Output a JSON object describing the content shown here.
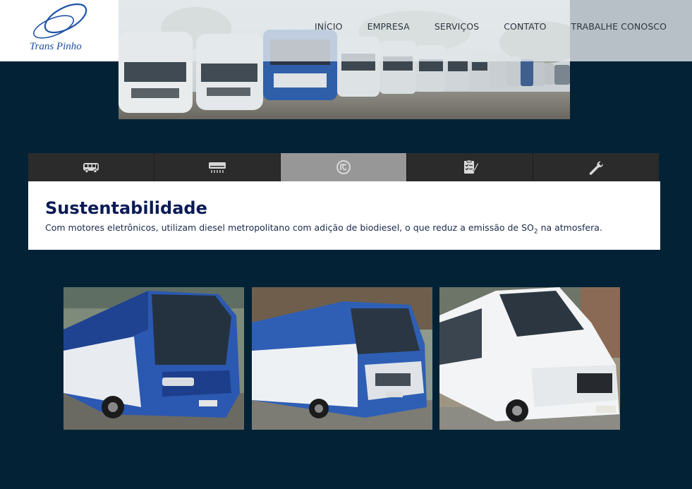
{
  "logo": {
    "text": "Trans Pinho"
  },
  "nav": {
    "items": [
      "INÍCIO",
      "EMPRESA",
      "SERVIÇOS",
      "CONTATO",
      "TRABALHE CONOSCO"
    ]
  },
  "tabs": [
    {
      "icon": "bus-icon"
    },
    {
      "icon": "air-conditioner-icon"
    },
    {
      "icon": "recycle-icon",
      "active": true
    },
    {
      "icon": "checklist-icon"
    },
    {
      "icon": "wrench-icon"
    }
  ],
  "panel": {
    "title": "Sustentabilidade",
    "text_before": "Com motores eletrônicos, utilizam diesel metropolitano com adição de biodiesel, o que reduz a emissão de SO",
    "text_sub": "2",
    "text_after": " na atmosfera."
  },
  "gallery": [
    {
      "name": "blue-white-bus-photo"
    },
    {
      "name": "blue-microbus-photo"
    },
    {
      "name": "white-van-photo"
    }
  ],
  "colors": {
    "background": "#032236",
    "tab_bar": "#2b2b2b",
    "tab_active": "#979797",
    "title": "#0a1b55"
  }
}
